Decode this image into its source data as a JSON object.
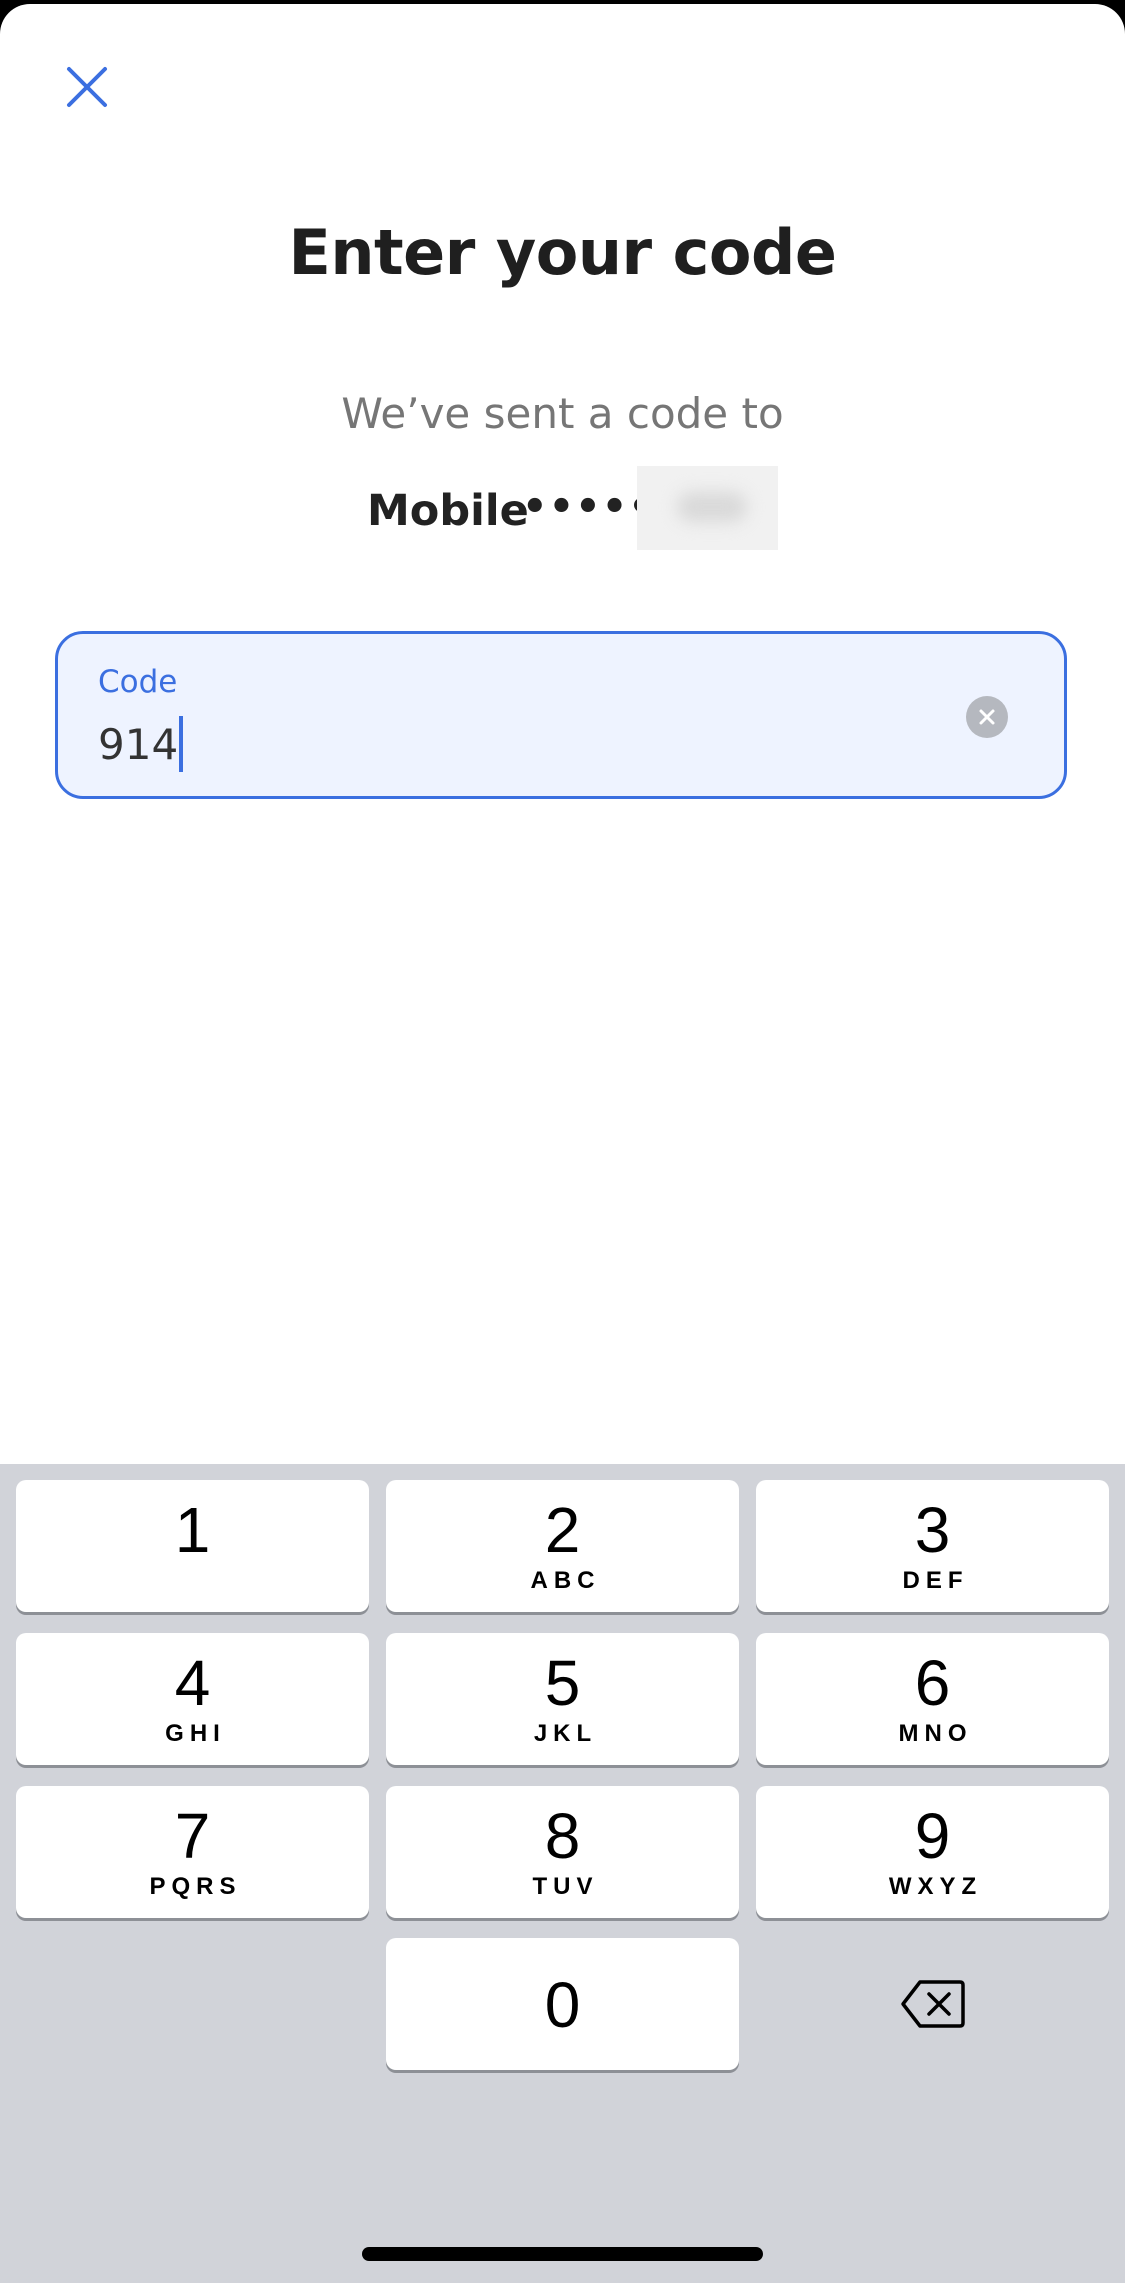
{
  "header": {
    "close_icon": "close-icon",
    "title": "Enter your code"
  },
  "verification": {
    "subtitle": "We’ve sent a code to",
    "destination_label": "Mobile",
    "destination_masked": "••••••",
    "redacted": "redacted-block"
  },
  "code_field": {
    "label": "Code",
    "value": "914",
    "clear_icon": "clear-circle-icon",
    "accent_color": "#3b6fe0",
    "background_color": "#eef3ff"
  },
  "keypad": {
    "keys": [
      {
        "digit": "1",
        "letters": ""
      },
      {
        "digit": "2",
        "letters": "ABC"
      },
      {
        "digit": "3",
        "letters": "DEF"
      },
      {
        "digit": "4",
        "letters": "GHI"
      },
      {
        "digit": "5",
        "letters": "JKL"
      },
      {
        "digit": "6",
        "letters": "MNO"
      },
      {
        "digit": "7",
        "letters": "PQRS"
      },
      {
        "digit": "8",
        "letters": "TUV"
      },
      {
        "digit": "9",
        "letters": "WXYZ"
      },
      {
        "digit": "0",
        "letters": ""
      }
    ],
    "backspace_icon": "backspace-icon",
    "background_color": "#d1d3d9"
  }
}
